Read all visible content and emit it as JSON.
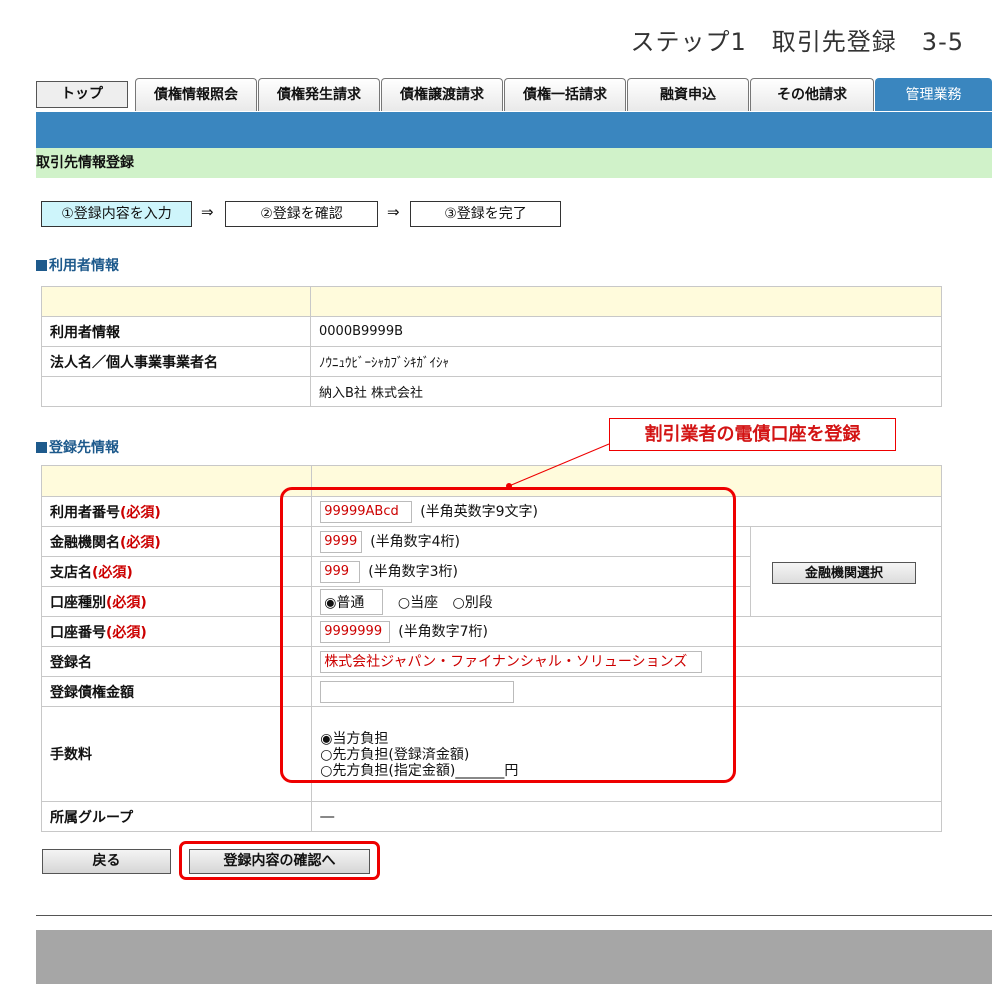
{
  "header": {
    "step_title": "ステップ1　取引先登録　3-5"
  },
  "tabs": [
    {
      "label": "トップ"
    },
    {
      "label": "債権情報照会"
    },
    {
      "label": "債権発生請求"
    },
    {
      "label": "債権譲渡請求"
    },
    {
      "label": "債権一括請求"
    },
    {
      "label": "融資申込"
    },
    {
      "label": "その他請求"
    },
    {
      "label": "管理業務"
    }
  ],
  "page_title": "取引先情報登録",
  "flow": {
    "step1": "①登録内容を入力",
    "step2": "②登録を確認",
    "step3": "③登録を完了",
    "arrow": "⇒"
  },
  "user_section": {
    "title": "利用者情報",
    "rows": {
      "user_info_label": "利用者情報",
      "user_info_value": "0000B9999B",
      "corp_name_label": "法人名／個人事業事業者名",
      "corp_name_kana": "ﾉｳﾆｭｳﾋﾞｰｼｬｶﾌﾞｼｷｶﾞｲｼｬ",
      "corp_name": "納入B社 株式会社"
    }
  },
  "reg_section": {
    "title": "登録先情報",
    "required_mark": "(必須)",
    "user_number_label": "利用者番号",
    "user_number_value": "99999ABcd",
    "user_number_note": "(半角英数字9文字)",
    "bank_name_label": "金融機関名",
    "bank_code_value": "9999",
    "bank_code_note": "(半角数字4桁)",
    "branch_label": "支店名",
    "branch_value": "999",
    "branch_note": "(半角数字3桁)",
    "account_type_label": "口座種別",
    "account_types": [
      "普通",
      "当座",
      "別段"
    ],
    "account_number_label": "口座番号",
    "account_number_value": "9999999",
    "account_number_note": "(半角数字7桁)",
    "reg_name_label": "登録名",
    "reg_name_value": "株式会社ジャパン・ファイナンシャル・ソリューションズ",
    "reg_amount_label": "登録債権金額",
    "reg_amount_value": "",
    "fee_label": "手数料",
    "fee_options": [
      "当方負担",
      "先方負担(登録済金額)",
      "先方負担(指定金額)_______円"
    ],
    "group_label": "所属グループ",
    "group_value": "―",
    "bank_select_button": "金融機関選択"
  },
  "callout": "割引業者の電債口座を登録",
  "buttons": {
    "back": "戻る",
    "confirm": "登録内容の確認へ"
  }
}
